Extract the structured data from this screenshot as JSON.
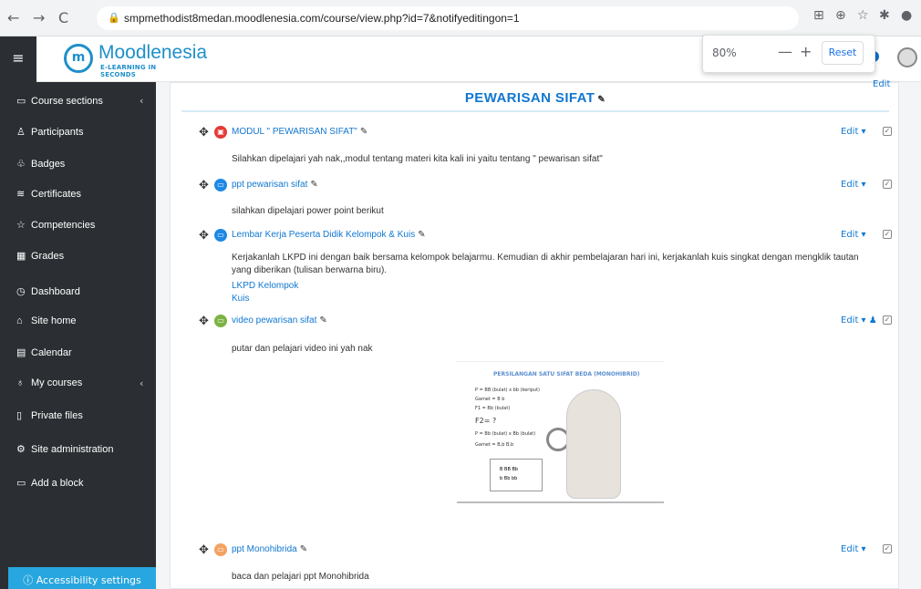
{
  "browser": {
    "url": "smpmethodist8medan.moodlenesia.com/course/view.php?id=7&notifyeditingon=1",
    "zoom_percent": "80%",
    "zoom_minus": "—",
    "zoom_plus": "+",
    "zoom_reset": "Reset"
  },
  "brand": {
    "name": "Moodlenesia",
    "tagline": "E-LEARNING IN SECONDS"
  },
  "sidebar": {
    "items": [
      {
        "label": "Course sections",
        "icon": "folder-icon",
        "chevron": "‹"
      },
      {
        "label": "Participants",
        "icon": "users-icon"
      },
      {
        "label": "Badges",
        "icon": "badge-icon"
      },
      {
        "label": "Certificates",
        "icon": "certificate-icon"
      },
      {
        "label": "Competencies",
        "icon": "star-icon"
      },
      {
        "label": "Grades",
        "icon": "grades-icon"
      },
      {
        "label": "Dashboard",
        "icon": "dashboard-icon"
      },
      {
        "label": "Site home",
        "icon": "home-icon"
      },
      {
        "label": "Calendar",
        "icon": "calendar-icon"
      },
      {
        "label": "My courses",
        "icon": "graduation-icon",
        "chevron": "‹"
      },
      {
        "label": "Private files",
        "icon": "files-icon"
      },
      {
        "label": "Site administration",
        "icon": "gear-icon"
      },
      {
        "label": "Add a block",
        "icon": "add-block-icon"
      }
    ],
    "accessibility": "Accessibility settings"
  },
  "section": {
    "title": "PEWARISAN SIFAT",
    "edit_label": "Edit"
  },
  "activities": [
    {
      "name": "MODUL \" PEWARISAN SIFAT\"",
      "icon": "pdf-icon",
      "color": "#e53935",
      "desc": "Silahkan dipelajari yah nak,,modul tentang materi kita kali ini yaitu tentang \" pewarisan sifat\""
    },
    {
      "name": "ppt pewarisan sifat",
      "icon": "file-icon",
      "color": "#1e88e5",
      "desc": "silahkan dipelajari power point berikut"
    },
    {
      "name": "Lembar Kerja Peserta Didik Kelompok & Kuis",
      "icon": "page-icon",
      "color": "#1e88e5",
      "desc": "Kerjakanlah LKPD ini dengan baik bersama kelompok belajarmu. Kemudian di akhir pembelajaran hari ini, kerjakanlah kuis singkat dengan mengklik tautan yang diberikan (tulisan berwarna biru).",
      "links": [
        "LKPD Kelompok",
        "Kuis"
      ]
    },
    {
      "name": "video pewarisan sifat",
      "icon": "video-icon",
      "color": "#7cb342",
      "desc": "putar dan pelajari video ini yah nak"
    },
    {
      "name": "ppt Monohibrida",
      "icon": "image-icon",
      "color": "#f4a261",
      "desc": "baca dan pelajari ppt Monohibrida"
    }
  ],
  "activity_edit_label": "Edit ▾",
  "video_thumb": {
    "title": "PERSILANGAN SATU SIFAT BEDA (MONOHIBRID)",
    "lines": [
      "P    = BB (bulat)   x    bb (keriput)",
      "Gamet = B          b",
      "F1   = Bb (bulat)",
      "F2= ?",
      "P    = Bb (bulat)  x  Bb (bulat)",
      "Gamet = B,b          B,b"
    ],
    "grid": [
      "B BB Bb",
      "b Bb bb"
    ]
  }
}
